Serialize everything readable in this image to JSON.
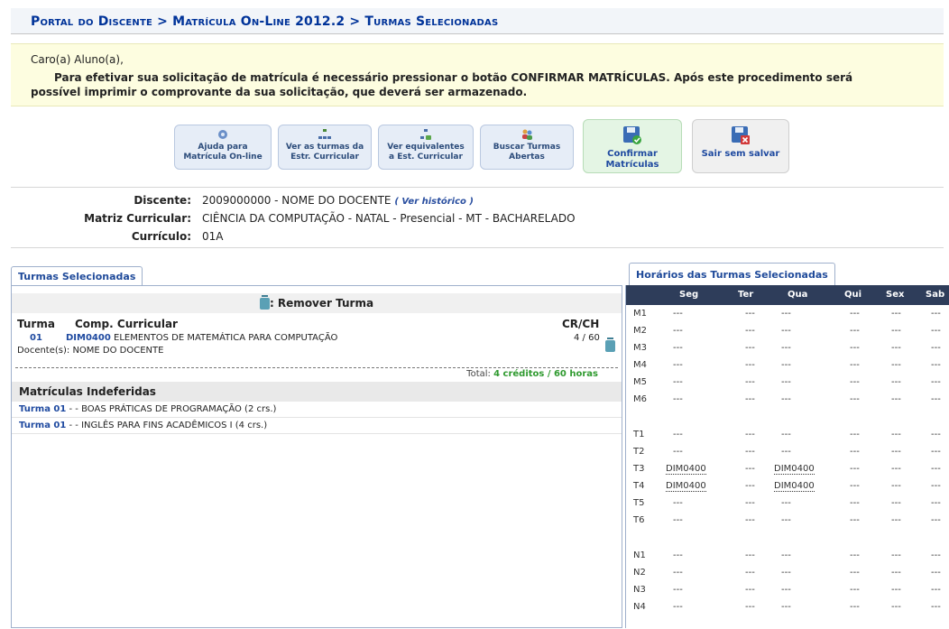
{
  "breadcrumb": "Portal do Discente > Matrícula On-Line 2012.2 > Turmas Selecionadas",
  "message": {
    "greeting": "Caro(a) Aluno(a),",
    "text": "Para efetivar sua solicitação de matrícula é necessário pressionar o botão CONFIRMAR MATRÍCULAS. Após este procedimento será possível imprimir o comprovante da sua solicitação, que deverá ser armazenado."
  },
  "toolbar": {
    "help": [
      "Ajuda para",
      "Matrícula On-line"
    ],
    "turmas_estr": [
      "Ver as turmas da",
      "Estr. Curricular"
    ],
    "equivalentes": [
      "Ver equivalentes",
      "a Est. Curricular"
    ],
    "buscar": [
      "Buscar Turmas",
      "Abertas"
    ],
    "confirmar": [
      "Confirmar",
      "Matrículas"
    ],
    "sair": "Sair sem salvar"
  },
  "info": {
    "discente_label": "Discente:",
    "discente_value": "2009000000 - NOME DO DOCENTE",
    "historico_link": "( Ver histórico )",
    "matriz_label": "Matriz Curricular:",
    "matriz_value": "CIÊNCIA DA COMPUTAÇÃO - NATAL - Presencial - MT - BACHARELADO",
    "curriculo_label": "Currículo:",
    "curriculo_value": "01A"
  },
  "tabs": {
    "left": "Turmas Selecionadas",
    "right": "Horários das Turmas Selecionadas"
  },
  "selected": {
    "remove_label": ": Remover Turma",
    "col_turma": "Turma",
    "col_comp": "Comp. Curricular",
    "col_crch": "CR/CH",
    "row": {
      "turma": "01",
      "code": "DIM0400",
      "name": "ELEMENTOS DE MATEMÁTICA PARA COMPUTAÇÃO",
      "crch": "4 / 60",
      "docente": "Docente(s): NOME DO DOCENTE"
    },
    "total_label": "Total:",
    "total_value": "4 créditos / 60 horas"
  },
  "indeferidas": {
    "title": "Matrículas Indeferidas",
    "items": [
      {
        "turma": "Turma 01",
        "text": " - - BOAS PRÁTICAS DE PROGRAMAÇÃO (2 crs.)"
      },
      {
        "turma": "Turma 01",
        "text": " - - INGLÊS PARA FINS ACADÊMICOS I (4 crs.)"
      }
    ]
  },
  "schedule": {
    "days": [
      "Seg",
      "Ter",
      "Qua",
      "Qui",
      "Sex",
      "Sab"
    ],
    "slots": [
      {
        "label": "M1",
        "values": [
          "---",
          "---",
          "---",
          "---",
          "---",
          "---"
        ]
      },
      {
        "label": "M2",
        "values": [
          "---",
          "---",
          "---",
          "---",
          "---",
          "---"
        ]
      },
      {
        "label": "M3",
        "values": [
          "---",
          "---",
          "---",
          "---",
          "---",
          "---"
        ]
      },
      {
        "label": "M4",
        "values": [
          "---",
          "---",
          "---",
          "---",
          "---",
          "---"
        ]
      },
      {
        "label": "M5",
        "values": [
          "---",
          "---",
          "---",
          "---",
          "---",
          "---"
        ]
      },
      {
        "label": "M6",
        "values": [
          "---",
          "---",
          "---",
          "---",
          "---",
          "---"
        ]
      },
      {
        "label": "T1",
        "values": [
          "---",
          "---",
          "---",
          "---",
          "---",
          "---"
        ]
      },
      {
        "label": "T2",
        "values": [
          "---",
          "---",
          "---",
          "---",
          "---",
          "---"
        ]
      },
      {
        "label": "T3",
        "values": [
          "DIM0400",
          "---",
          "DIM0400",
          "---",
          "---",
          "---"
        ]
      },
      {
        "label": "T4",
        "values": [
          "DIM0400",
          "---",
          "DIM0400",
          "---",
          "---",
          "---"
        ]
      },
      {
        "label": "T5",
        "values": [
          "---",
          "---",
          "---",
          "---",
          "---",
          "---"
        ]
      },
      {
        "label": "T6",
        "values": [
          "---",
          "---",
          "---",
          "---",
          "---",
          "---"
        ]
      },
      {
        "label": "N1",
        "values": [
          "---",
          "---",
          "---",
          "---",
          "---",
          "---"
        ]
      },
      {
        "label": "N2",
        "values": [
          "---",
          "---",
          "---",
          "---",
          "---",
          "---"
        ]
      },
      {
        "label": "N3",
        "values": [
          "---",
          "---",
          "---",
          "---",
          "---",
          "---"
        ]
      },
      {
        "label": "N4",
        "values": [
          "---",
          "---",
          "---",
          "---",
          "---",
          "---"
        ]
      }
    ]
  }
}
